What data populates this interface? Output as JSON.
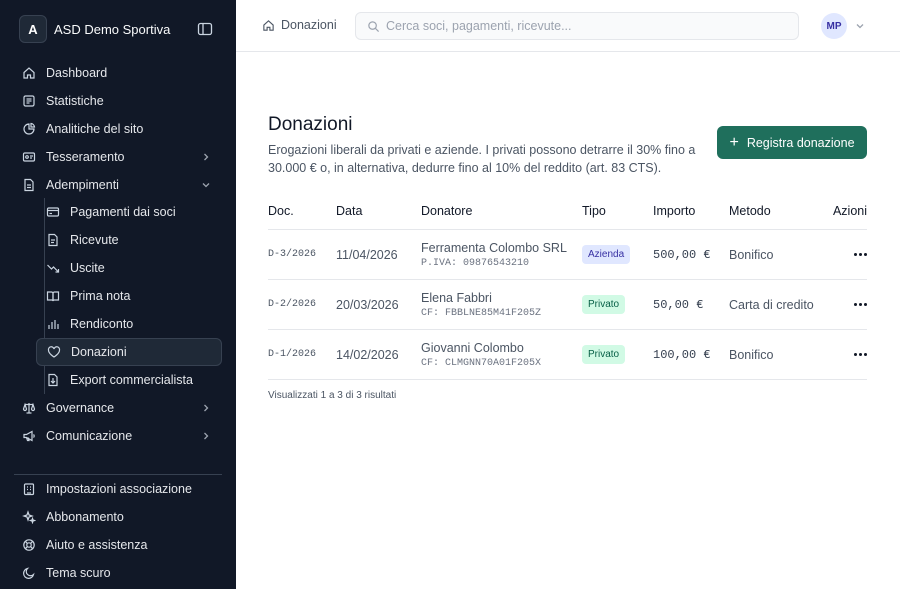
{
  "brand": {
    "initial": "A",
    "name": "ASD Demo Sportiva"
  },
  "sidebar": {
    "items": [
      {
        "label": "Dashboard",
        "icon": "home-icon"
      },
      {
        "label": "Statistiche",
        "icon": "chart-box-icon"
      },
      {
        "label": "Analitiche del sito",
        "icon": "pie-icon"
      },
      {
        "label": "Tesseramento",
        "icon": "id-card-icon",
        "chevron": "right"
      },
      {
        "label": "Adempimenti",
        "icon": "document-icon",
        "chevron": "down"
      }
    ],
    "subitems": [
      {
        "label": "Pagamenti dai soci",
        "icon": "credit-card-icon"
      },
      {
        "label": "Ricevute",
        "icon": "receipt-icon"
      },
      {
        "label": "Uscite",
        "icon": "trend-down-icon"
      },
      {
        "label": "Prima nota",
        "icon": "book-icon"
      },
      {
        "label": "Rendiconto",
        "icon": "bar-chart-icon"
      },
      {
        "label": "Donazioni",
        "icon": "heart-icon",
        "active": true
      },
      {
        "label": "Export commercialista",
        "icon": "file-export-icon"
      }
    ],
    "after_items": [
      {
        "label": "Governance",
        "icon": "scale-icon",
        "chevron": "right"
      },
      {
        "label": "Comunicazione",
        "icon": "megaphone-icon",
        "chevron": "right"
      }
    ],
    "bottom_items": [
      {
        "label": "Impostazioni associazione",
        "icon": "building-icon"
      },
      {
        "label": "Abbonamento",
        "icon": "sparkles-icon"
      },
      {
        "label": "Aiuto e assistenza",
        "icon": "lifebuoy-icon"
      },
      {
        "label": "Tema scuro",
        "icon": "moon-icon"
      }
    ]
  },
  "topbar": {
    "breadcrumb": "Donazioni",
    "search_placeholder": "Cerca soci, pagamenti, ricevute...",
    "user_initials": "MP"
  },
  "main": {
    "title": "Donazioni",
    "description": "Erogazioni liberali da privati e aziende. I privati possono detrarre il 30% fino a 30.000 € o, in alternativa, dedurre fino al 10% del reddito (art. 83 CTS).",
    "add_button": "Registra donazione",
    "columns": [
      "Doc.",
      "Data",
      "Donatore",
      "Tipo",
      "Importo",
      "Metodo",
      "Azioni"
    ],
    "rows": [
      {
        "doc": "D-3/2026",
        "date": "11/04/2026",
        "donor": "Ferramenta Colombo SRL",
        "donor_id": "P.IVA: 09876543210",
        "type": "Azienda",
        "amount": "500,00 €",
        "method": "Bonifico"
      },
      {
        "doc": "D-2/2026",
        "date": "20/03/2026",
        "donor": "Elena Fabbri",
        "donor_id": "CF: FBBLNE85M41F205Z",
        "type": "Privato",
        "amount": "50,00 €",
        "method": "Carta di credito"
      },
      {
        "doc": "D-1/2026",
        "date": "14/02/2026",
        "donor": "Giovanni Colombo",
        "donor_id": "CF: CLMGNN70A01F205X",
        "type": "Privato",
        "amount": "100,00 €",
        "method": "Bonifico"
      }
    ],
    "footer": "Visualizzati 1 a 3 di 3 risultati"
  },
  "colors": {
    "sidebar_bg": "#111827",
    "primary": "#1f6f5c",
    "badge_azienda_bg": "#e0e7ff",
    "badge_azienda_fg": "#3730a3",
    "badge_privato_bg": "#d1fae5",
    "badge_privato_fg": "#065f46"
  }
}
